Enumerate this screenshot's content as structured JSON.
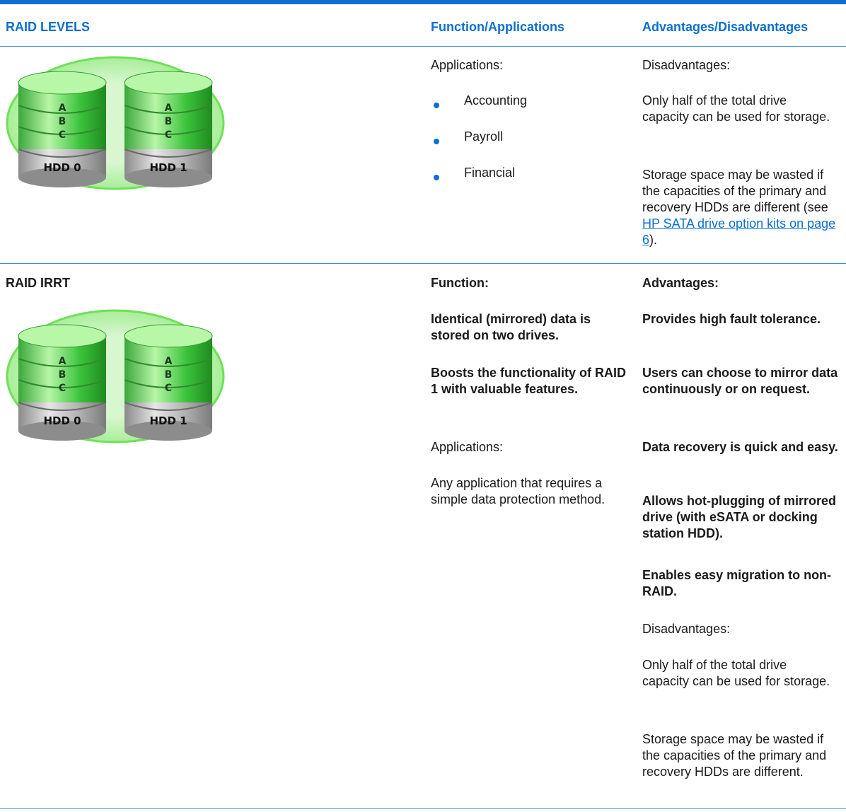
{
  "header": {
    "col1": "RAID LEVELS",
    "col2": "Function/Applications",
    "col3": "Advantages/Disadvantages"
  },
  "row1": {
    "image": {
      "drive_letters": [
        "A",
        "B",
        "C"
      ],
      "drive_labels": [
        "HDD 0",
        "HDD 1"
      ]
    },
    "function": {
      "applications_label": "Applications:",
      "bullets": [
        "Accounting",
        "Payroll",
        "Financial"
      ]
    },
    "advantages": {
      "disadvantages_label": "Disadvantages:",
      "p1": "Only half of the total drive capacity can be used for storage.",
      "p2_start": "Storage space may be wasted if the capacities of the primary and recovery HDDs are different (see ",
      "p2_link": "HP SATA drive option kits on page 6",
      "p2_end": ")."
    }
  },
  "row2": {
    "title": "RAID IRRT",
    "image": {
      "drive_letters": [
        "A",
        "B",
        "C"
      ],
      "drive_labels": [
        "HDD 0",
        "HDD 1"
      ]
    },
    "function": {
      "label": "Function:",
      "p1": "Identical (mirrored) data is stored on two drives.",
      "p2": "Boosts the functionality of RAID 1 with valuable features.",
      "applications_label": "Applications:",
      "p3": "Any application that requires a simple data protection method."
    },
    "advantages": {
      "label": "Advantages:",
      "a1": "Provides high fault tolerance.",
      "a2": "Users can choose to mirror data continuously or on request.",
      "a3": "Data recovery is quick and easy.",
      "a4": "Allows hot-plugging of mirrored drive (with eSATA or docking station HDD).",
      "a5": "Enables easy migration to non-RAID.",
      "disadvantages_label": "Disadvantages:",
      "d1": "Only half of the total drive capacity can be used for storage.",
      "d2": "Storage space may be wasted if the capacities of the primary and recovery HDDs are different."
    }
  }
}
